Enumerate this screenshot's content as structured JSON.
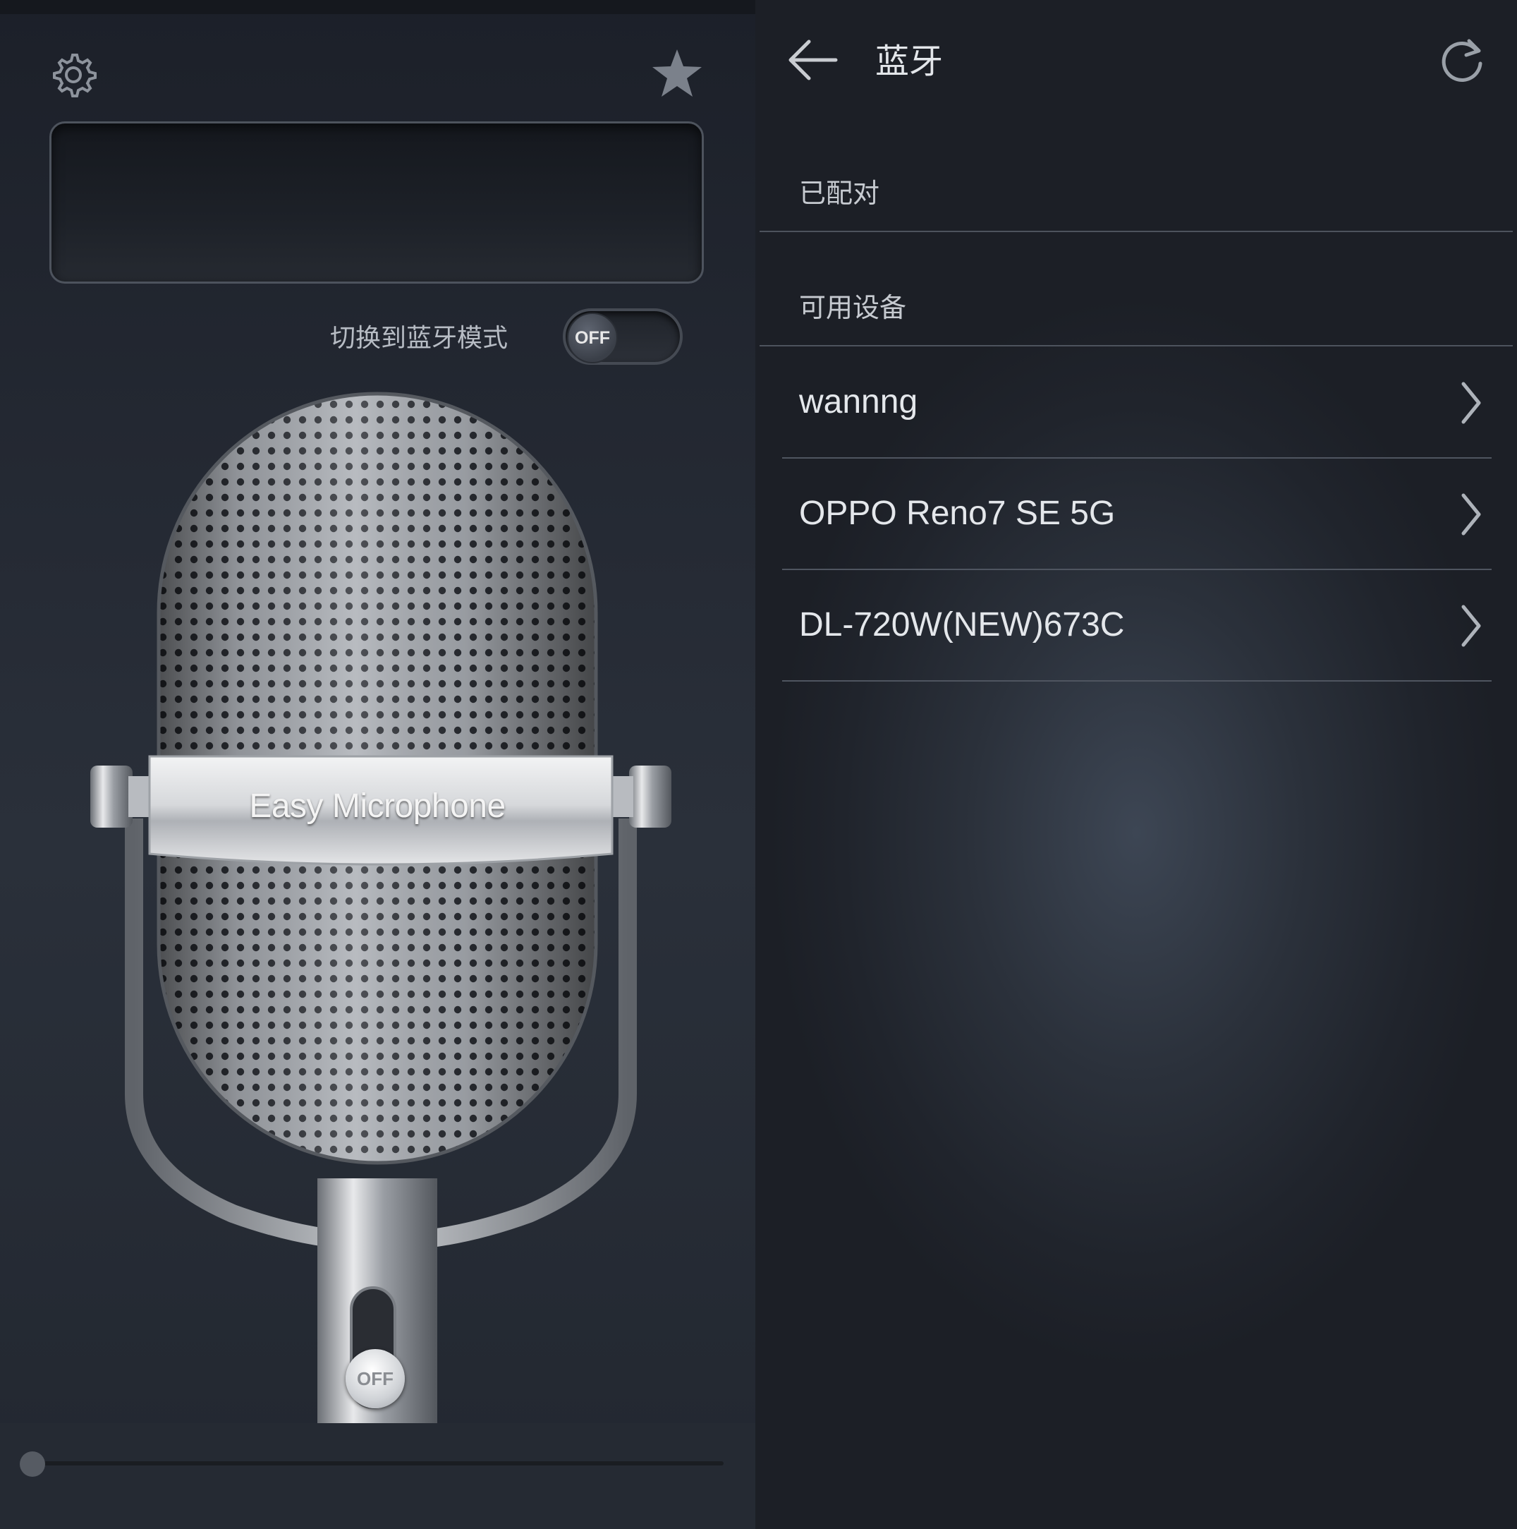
{
  "left_panel": {
    "bluetooth_mode_label": "切换到蓝牙模式",
    "bluetooth_toggle": {
      "state": "OFF"
    },
    "microphone": {
      "brand_label": "Easy Microphone",
      "power_switch": "OFF"
    },
    "volume_slider": {
      "value": 0
    },
    "icons": {
      "settings": "gear-icon",
      "favorite": "star-icon"
    }
  },
  "right_panel": {
    "header": {
      "title": "蓝牙",
      "back_icon": "arrow-left-icon",
      "refresh_icon": "refresh-icon"
    },
    "paired_section": {
      "title": "已配对"
    },
    "available_section": {
      "title": "可用设备",
      "devices": [
        {
          "name": "wannng"
        },
        {
          "name": "OPPO Reno7 SE 5G"
        },
        {
          "name": "DL-720W(NEW)673C"
        }
      ]
    }
  },
  "colors": {
    "background": "#1b1f27",
    "text": "#e4e7eb",
    "divider": "#4f5560"
  }
}
